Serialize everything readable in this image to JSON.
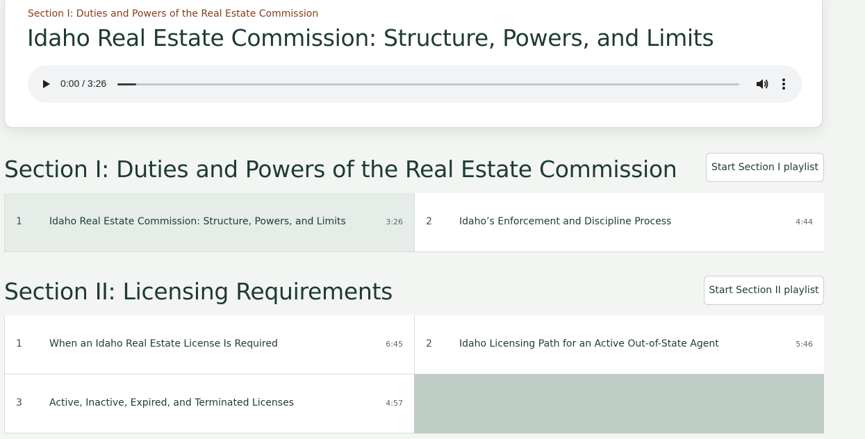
{
  "now_playing": {
    "kicker": "Section I: Duties and Powers of the Real Estate Commission",
    "title": "Idaho Real Estate Commission: Structure, Powers, and Limits",
    "player": {
      "time": "0:00 / 3:26",
      "progress": 0.03
    }
  },
  "sections": [
    {
      "title": "Section I: Duties and Powers of the Real Estate Commission",
      "playlist_label": "Start Section I playlist",
      "tracks": [
        {
          "num": "1",
          "name": "Idaho Real Estate Commission: Structure, Powers, and Limits",
          "duration": "3:26",
          "active": true
        },
        {
          "num": "2",
          "name": "Idaho’s Enforcement and Discipline Process",
          "duration": "4:44",
          "active": false
        }
      ]
    },
    {
      "title": "Section II: Licensing Requirements",
      "playlist_label": "Start Section II playlist",
      "tracks": [
        {
          "num": "1",
          "name": "When an Idaho Real Estate License Is Required",
          "duration": "6:45",
          "active": false
        },
        {
          "num": "2",
          "name": "Idaho Licensing Path for an Active Out-of-State Agent",
          "duration": "5:46",
          "active": false
        },
        {
          "num": "3",
          "name": "Active, Inactive, Expired, and Terminated Licenses",
          "duration": "4:57",
          "active": false
        }
      ]
    }
  ],
  "icons": {
    "play": "play-icon",
    "volume": "volume-icon",
    "more": "more-vertical-icon"
  },
  "colors": {
    "accent_text": "#8a3d1c",
    "heading": "#1d3a35",
    "active_row": "#e6ede9",
    "empty_cell": "#bfcdc7"
  }
}
